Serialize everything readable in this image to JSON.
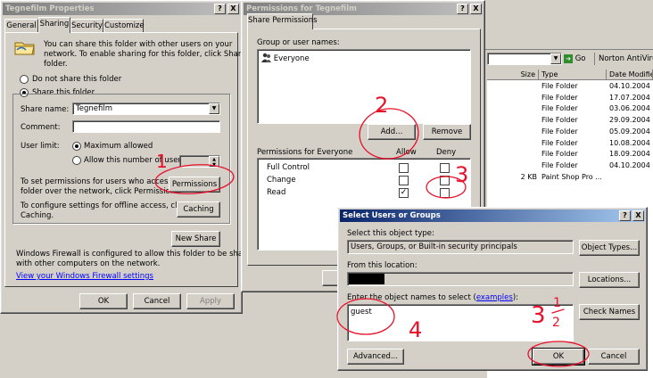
{
  "explorer": {
    "go_label": "Go",
    "norton_label": "Norton AntiVirus",
    "columns": [
      "Size",
      "Type",
      "Date Modified"
    ],
    "rows": [
      {
        "size": "",
        "type": "File Folder",
        "date": "04.10.2004"
      },
      {
        "size": "",
        "type": "File Folder",
        "date": "17.07.2004"
      },
      {
        "size": "",
        "type": "File Folder",
        "date": "03.06.2004"
      },
      {
        "size": "",
        "type": "File Folder",
        "date": "29.09.2004"
      },
      {
        "size": "",
        "type": "File Folder",
        "date": "05.09.2004"
      },
      {
        "size": "",
        "type": "File Folder",
        "date": "10.08.2004"
      },
      {
        "size": "",
        "type": "File Folder",
        "date": "18.09.2004"
      },
      {
        "size": "",
        "type": "File Folder",
        "date": "04.10.2004"
      },
      {
        "size": "2 KB",
        "type": "Paint Shop Pro ...",
        "date": ""
      }
    ]
  },
  "props": {
    "title": "Tegnefilm Properties",
    "tabs": [
      "General",
      "Sharing",
      "Security",
      "Customize"
    ],
    "intro": [
      "You can share this folder with other users on your",
      "network.  To enable sharing for this folder, click Share this",
      "folder."
    ],
    "radio_no_share": "Do not share this folder",
    "radio_share": "Share this folder",
    "share_name_label": "Share name:",
    "share_name_value": "Tegnefilm",
    "comment_label": "Comment:",
    "user_limit_label": "User limit:",
    "max_allowed": "Maximum allowed",
    "allow_number": "Allow this number of users:",
    "perm_text": [
      "To set permissions for users who access this",
      "folder over the network, click Permissions."
    ],
    "permissions_button": "Permissions",
    "caching_text": [
      "To configure settings for offline access, click",
      "Caching."
    ],
    "caching_button": "Caching",
    "new_share_button": "New Share",
    "firewall_text": [
      "Windows Firewall is configured to allow this folder to be shared",
      "with other computers on the network."
    ],
    "firewall_link": "View your Windows Firewall settings",
    "ok": "OK",
    "cancel": "Cancel",
    "apply": "Apply"
  },
  "perms": {
    "title": "Permissions for Tegnefilm",
    "tab": "Share Permissions",
    "group_label": "Group or user names:",
    "users": [
      "Everyone"
    ],
    "add_button": "Add...",
    "remove_button": "Remove",
    "perm_for_label": "Permissions for Everyone",
    "allow_header": "Allow",
    "deny_header": "Deny",
    "rows": [
      {
        "name": "Full Control",
        "allow": false,
        "deny": false
      },
      {
        "name": "Change",
        "allow": false,
        "deny": false
      },
      {
        "name": "Read",
        "allow": true,
        "deny": false
      }
    ]
  },
  "select": {
    "title": "Select Users or Groups",
    "type_label": "Select this object type:",
    "type_value": "Users, Groups, or Built-in security principals",
    "object_types_button": "Object Types...",
    "location_label": "From this location:",
    "locations_button": "Locations...",
    "names_label_prefix": "Enter the object names to select (",
    "names_label_link": "examples",
    "names_label_suffix": "):",
    "names_value": "guest",
    "check_names_button": "Check Names",
    "advanced_button": "Advanced...",
    "ok": "OK",
    "cancel": "Cancel"
  },
  "titlebar_buttons": {
    "help": "?",
    "close": "X"
  },
  "annotations": [
    "1",
    "2",
    "3",
    "4",
    "3",
    "1",
    "2"
  ],
  "colors": {
    "annotation": "#e8102a",
    "title_active": "#0a246a",
    "face": "#d4d0c8"
  }
}
